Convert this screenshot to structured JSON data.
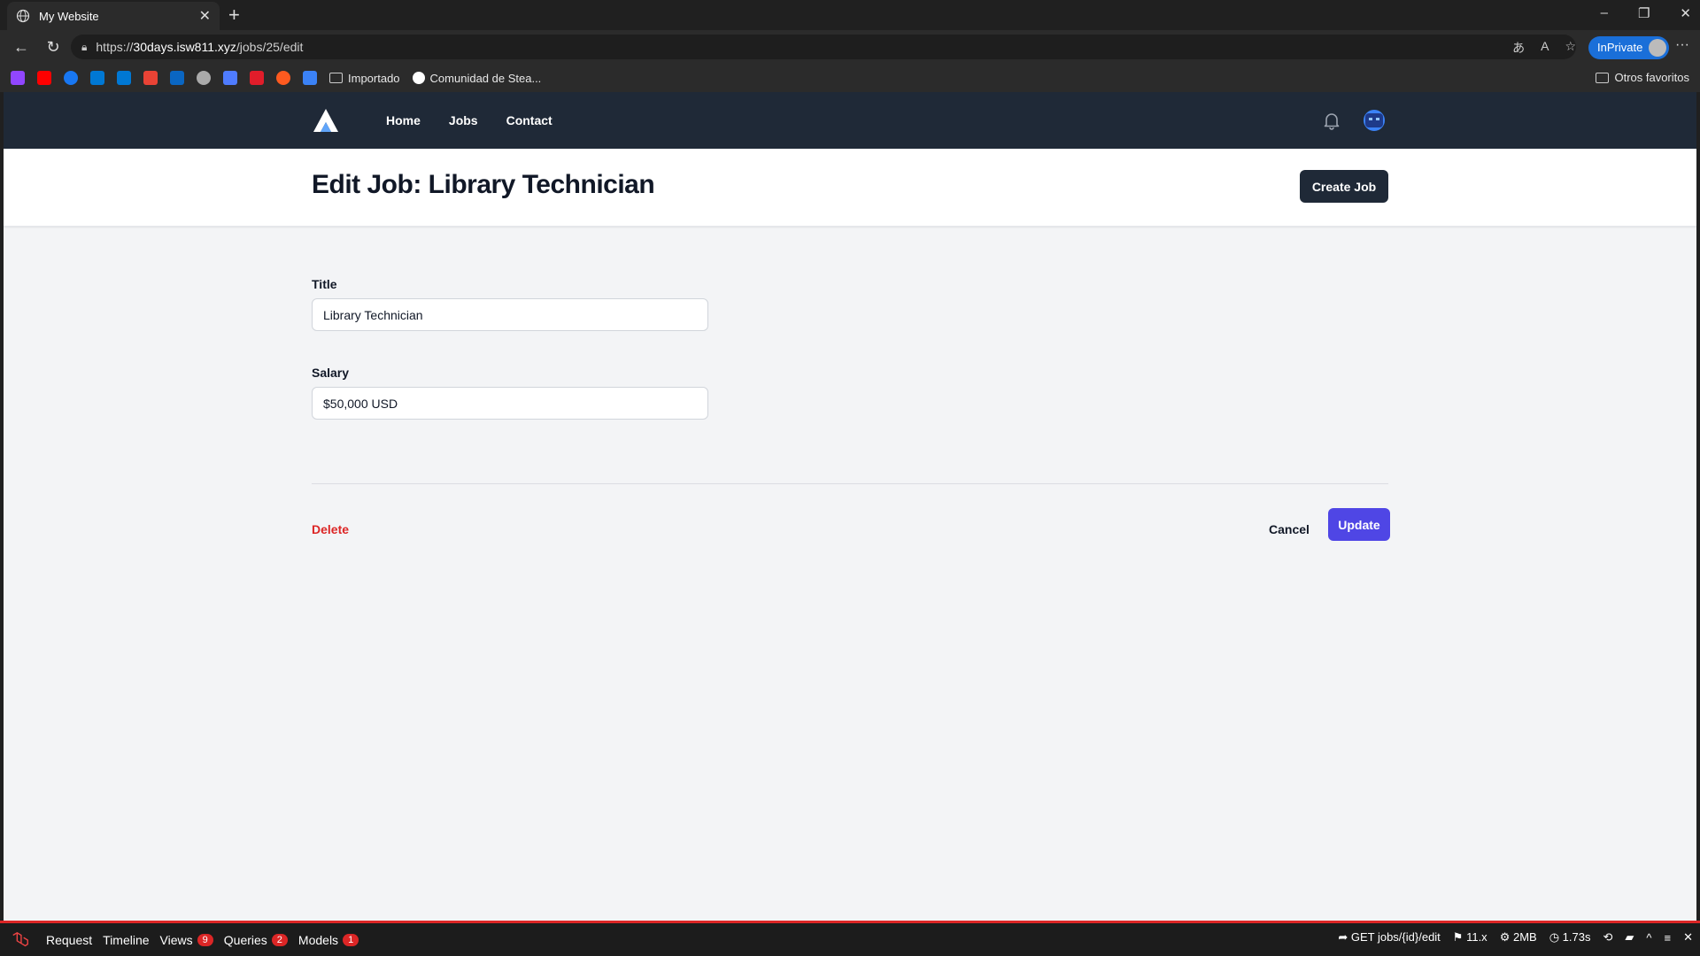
{
  "browser": {
    "tab_title": "My Website",
    "url_prefix": "https://",
    "url_host": "30days.isw811.xyz",
    "url_path": "/jobs/25/edit",
    "inprivate_label": "InPrivate",
    "bookmarks": [
      {
        "label": "Importado",
        "type": "folder"
      },
      {
        "label": "Comunidad de Stea...",
        "type": "link"
      }
    ],
    "other_favorites": "Otros favoritos"
  },
  "app": {
    "nav": {
      "home": "Home",
      "jobs": "Jobs",
      "contact": "Contact"
    },
    "header": {
      "title": "Edit Job: Library Technician",
      "create_button": "Create Job"
    },
    "form": {
      "title_label": "Title",
      "title_value": "Library Technician",
      "salary_label": "Salary",
      "salary_value": "$50,000 USD",
      "delete": "Delete",
      "cancel": "Cancel",
      "update": "Update"
    }
  },
  "debugbar": {
    "request": "Request",
    "timeline": "Timeline",
    "views": "Views",
    "views_count": "9",
    "queries": "Queries",
    "queries_count": "2",
    "models": "Models",
    "models_count": "1",
    "route": "GET jobs/{id}/edit",
    "version": "11.x",
    "memory": "2MB",
    "time": "1.73s"
  },
  "colors": {
    "nav_bg": "#1f2937",
    "primary": "#4f46e5",
    "danger": "#dc2626",
    "page_bg": "#f3f4f6"
  }
}
